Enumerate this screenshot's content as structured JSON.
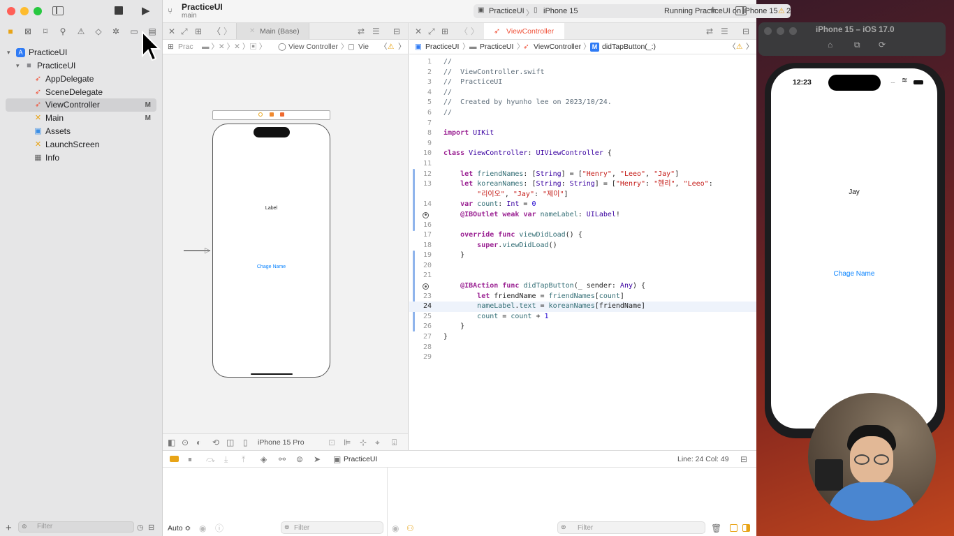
{
  "sidebar": {
    "project": "PracticeUI",
    "group": "PracticeUI",
    "files": [
      {
        "name": "AppDelegate",
        "badge": ""
      },
      {
        "name": "SceneDelegate",
        "badge": ""
      },
      {
        "name": "ViewController",
        "badge": "M"
      },
      {
        "name": "Main",
        "badge": "M"
      },
      {
        "name": "Assets",
        "badge": ""
      },
      {
        "name": "LaunchScreen",
        "badge": ""
      },
      {
        "name": "Info",
        "badge": ""
      }
    ],
    "filter_placeholder": "Filter"
  },
  "toolbar": {
    "scheme_title": "PracticeUI",
    "scheme_branch": "main",
    "run_target_project": "PracticeUI",
    "run_target_device": "iPhone 15",
    "status": "Running PracticeUI on iPhone 15",
    "warning_count": "2"
  },
  "storyboard": {
    "tab": "Main (Base)",
    "jump_bar": [
      "Prac",
      "View Controller",
      "Vie"
    ],
    "label_text": "Label",
    "button_text": "Chage Name",
    "device": "iPhone 15 Pro"
  },
  "editor": {
    "tab": "ViewController",
    "jump_bar": [
      "PracticeUI",
      "PracticeUI",
      "ViewController",
      "didTapButton(_:)"
    ],
    "method_badge": "M",
    "lines": [
      {
        "n": "1",
        "t": "//"
      },
      {
        "n": "2",
        "t": "//  ViewController.swift"
      },
      {
        "n": "3",
        "t": "//  PracticeUI"
      },
      {
        "n": "4",
        "t": "//"
      },
      {
        "n": "5",
        "t": "//  Created by hyunho lee on 2023/10/24."
      },
      {
        "n": "6",
        "t": "//"
      },
      {
        "n": "7",
        "t": ""
      },
      {
        "n": "8",
        "t": "import UIKit"
      },
      {
        "n": "9",
        "t": ""
      },
      {
        "n": "10",
        "t": "class ViewController: UIViewController {"
      },
      {
        "n": "11",
        "t": ""
      },
      {
        "n": "12",
        "t": "    let friendNames: [String] = [\"Henry\", \"Leeo\", \"Jay\"]"
      },
      {
        "n": "13",
        "t": "    let koreanNames: [String: String] = [\"Henry\": \"헨리\", \"Leeo\":"
      },
      {
        "n": "",
        "t": "        \"리이오\", \"Jay\": \"제이\"]"
      },
      {
        "n": "14",
        "t": "    var count: Int = 0"
      },
      {
        "n": "15",
        "t": "    @IBOutlet weak var nameLabel: UILabel!"
      },
      {
        "n": "16",
        "t": ""
      },
      {
        "n": "17",
        "t": "    override func viewDidLoad() {"
      },
      {
        "n": "18",
        "t": "        super.viewDidLoad()"
      },
      {
        "n": "19",
        "t": "    }"
      },
      {
        "n": "20",
        "t": ""
      },
      {
        "n": "21",
        "t": ""
      },
      {
        "n": "22",
        "t": "    @IBAction func didTapButton(_ sender: Any) {"
      },
      {
        "n": "23",
        "t": "        let friendName = friendNames[count]"
      },
      {
        "n": "24",
        "t": "        nameLabel.text = koreanNames[friendName]"
      },
      {
        "n": "25",
        "t": "        count = count + 1"
      },
      {
        "n": "26",
        "t": "    }"
      },
      {
        "n": "27",
        "t": "}"
      },
      {
        "n": "28",
        "t": ""
      },
      {
        "n": "29",
        "t": ""
      }
    ]
  },
  "debug": {
    "target": "PracticeUI",
    "cursor_pos": "Line: 24  Col: 49",
    "auto_label": "Auto ≎",
    "filter_placeholder": "Filter"
  },
  "simulator": {
    "title": "iPhone 15 – iOS 17.0",
    "time": "12:23",
    "label_text": "Jay",
    "button_text": "Chage Name"
  },
  "colors": {
    "accent": "#0a84ff",
    "swift_orange": "#f05138",
    "keyword": "#9b2393",
    "string": "#c41a16"
  }
}
